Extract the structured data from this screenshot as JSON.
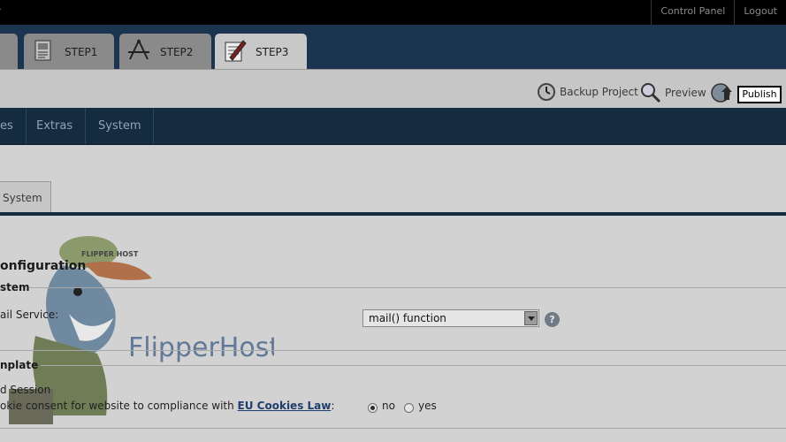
{
  "topbar": {
    "brand_fragment": "r",
    "links": [
      "Control Panel",
      "Logout"
    ]
  },
  "steps": [
    {
      "label": "",
      "icon": "step-partial-icon"
    },
    {
      "label": "STEP1",
      "icon": "document-icon"
    },
    {
      "label": "STEP2",
      "icon": "drafting-tools-icon"
    },
    {
      "label": "STEP3",
      "icon": "pencil-notepad-icon"
    }
  ],
  "toolbar": {
    "backup_label": "Backup Project",
    "preview_label": "Preview",
    "publish_label": "Publish"
  },
  "menu": {
    "items": [
      "es",
      "Extras",
      "System"
    ]
  },
  "subtabs": {
    "active": "System"
  },
  "config": {
    "heading": "onfiguration",
    "section_system": "stem",
    "mail_label": "ail Service:",
    "mail_value": "mail() function",
    "section_template": "nplate",
    "session_label": "d Session",
    "cookie_prefix": "okie consent for website to compliance with ",
    "cookie_link": "EU Cookies Law",
    "cookie_suffix": ":",
    "radio_no": "no",
    "radio_yes": "yes",
    "selected": "no"
  },
  "watermark": {
    "text": "FlipperHost",
    "cap_text": "FLIPPER HOST"
  },
  "colors": {
    "topbar": "#000000",
    "steps_bar": "#1b3550",
    "menubar": "#152b40",
    "link": "#1f3e6e"
  }
}
